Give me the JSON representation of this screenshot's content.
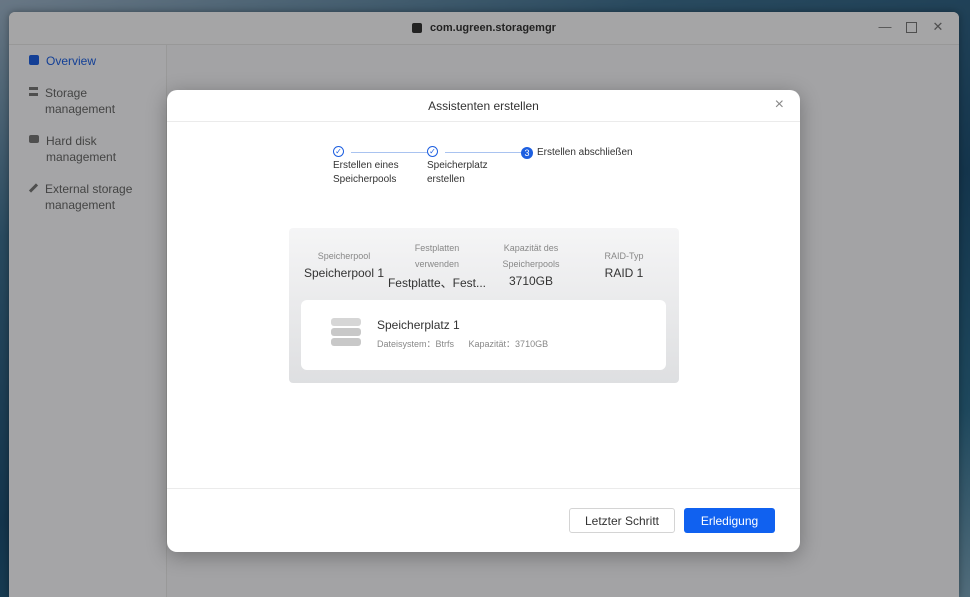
{
  "window": {
    "title": "com.ugreen.storagemgr"
  },
  "sidebar": {
    "items": [
      {
        "label": "Overview",
        "active": true,
        "icon": "overview-icon"
      },
      {
        "label": "Storage management",
        "icon": "database-icon"
      },
      {
        "label": "Hard disk management",
        "icon": "hard-disk-icon"
      },
      {
        "label": "External storage management",
        "icon": "pen-icon"
      }
    ]
  },
  "dialog": {
    "title": "Assistenten erstellen",
    "close_glyph": "×",
    "steps": [
      {
        "label_line1": "Erstellen eines",
        "label_line2": "Speicherpools",
        "state": "done"
      },
      {
        "label_line1": "Speicherplatz",
        "label_line2": "erstellen",
        "state": "done"
      },
      {
        "number": "3",
        "label": "Erstellen abschließen",
        "state": "current"
      }
    ],
    "pool": {
      "name_label": "Speicherpool",
      "name_value": "Speicherpool 1",
      "disks_label_line1": "Festplatten",
      "disks_label_line2": "verwenden",
      "disks_value": "Festplatte、Fest...",
      "capacity_label_line1": "Kapazität des",
      "capacity_label_line2": "Speicherpools",
      "capacity_value": "3710GB",
      "raid_label": "RAID-Typ",
      "raid_value": "RAID 1"
    },
    "space": {
      "name": "Speicherplatz 1",
      "filesystem": "Dateisystem：Btrfs",
      "capacity": "Kapazität：3710GB"
    },
    "buttons": {
      "back": "Letzter Schritt",
      "done": "Erledigung"
    }
  },
  "colors": {
    "accent": "#1061f0"
  }
}
